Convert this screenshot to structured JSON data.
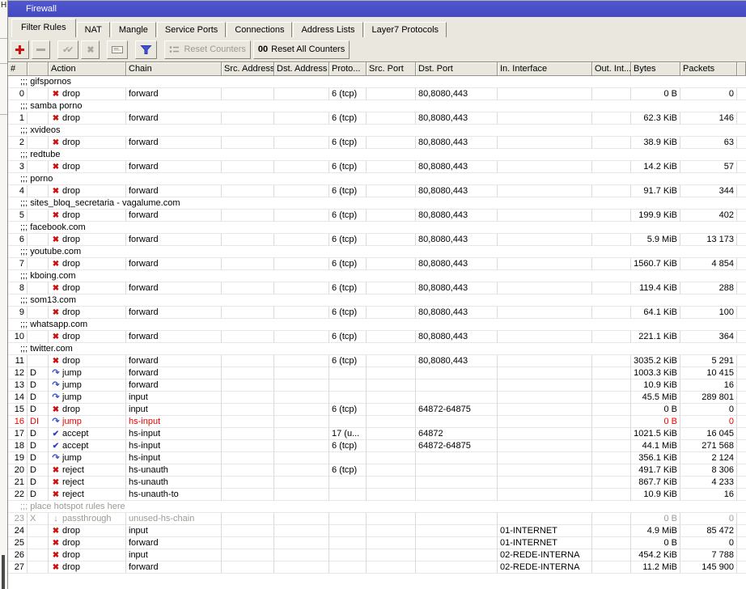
{
  "window": {
    "title": "Firewall"
  },
  "background": {
    "partial_text": "H"
  },
  "tabs": [
    {
      "label": "Filter Rules",
      "active": true
    },
    {
      "label": "NAT",
      "active": false
    },
    {
      "label": "Mangle",
      "active": false
    },
    {
      "label": "Service Ports",
      "active": false
    },
    {
      "label": "Connections",
      "active": false
    },
    {
      "label": "Address Lists",
      "active": false
    },
    {
      "label": "Layer7 Protocols",
      "active": false
    }
  ],
  "toolbar": {
    "reset_counters": "Reset Counters",
    "reset_all_prefix": "00",
    "reset_all": "Reset All Counters"
  },
  "icons": {
    "enable": "✔✔",
    "disable": "✖"
  },
  "action_icons": {
    "drop": "✖",
    "reject": "✖",
    "jump": "↷",
    "accept": "✔",
    "passthrough": "↓"
  },
  "colors": {
    "titlebar_blue": "#4b51c8",
    "chrome_grey": "#eae7df",
    "invalid_red": "#f00000",
    "disabled_grey": "#9c9a92",
    "drop_red": "#cc1111",
    "jump_blue": "#3a55cf",
    "accept_blue": "#2f3fc4"
  },
  "table": {
    "comment_prefix": ";;;",
    "columns": [
      {
        "key": "num",
        "label": "#",
        "align": "right"
      },
      {
        "key": "flags",
        "label": "",
        "align": "left"
      },
      {
        "key": "action",
        "label": "Action",
        "align": "left"
      },
      {
        "key": "chain",
        "label": "Chain",
        "align": "left"
      },
      {
        "key": "src_address",
        "label": "Src. Address",
        "align": "left"
      },
      {
        "key": "dst_address",
        "label": "Dst. Address",
        "align": "left"
      },
      {
        "key": "protocol",
        "label": "Proto...",
        "align": "left"
      },
      {
        "key": "src_port",
        "label": "Src. Port",
        "align": "left"
      },
      {
        "key": "dst_port",
        "label": "Dst. Port",
        "align": "left"
      },
      {
        "key": "in_interface",
        "label": "In. Interface",
        "align": "left"
      },
      {
        "key": "out_interface",
        "label": "Out. Int...",
        "align": "left"
      },
      {
        "key": "bytes",
        "label": "Bytes",
        "align": "right"
      },
      {
        "key": "packets",
        "label": "Packets",
        "align": "right"
      },
      {
        "key": "filler",
        "label": "",
        "align": "left"
      }
    ],
    "rows": [
      {
        "type": "comment",
        "text": "gifspornos"
      },
      {
        "type": "rule",
        "num": "0",
        "flags": "",
        "action": "drop",
        "chain": "forward",
        "protocol": "6 (tcp)",
        "dst_port": "80,8080,443",
        "bytes": "0 B",
        "packets": "0"
      },
      {
        "type": "comment",
        "text": "samba porno"
      },
      {
        "type": "rule",
        "num": "1",
        "flags": "",
        "action": "drop",
        "chain": "forward",
        "protocol": "6 (tcp)",
        "dst_port": "80,8080,443",
        "bytes": "62.3 KiB",
        "packets": "146"
      },
      {
        "type": "comment",
        "text": "xvideos"
      },
      {
        "type": "rule",
        "num": "2",
        "flags": "",
        "action": "drop",
        "chain": "forward",
        "protocol": "6 (tcp)",
        "dst_port": "80,8080,443",
        "bytes": "38.9 KiB",
        "packets": "63"
      },
      {
        "type": "comment",
        "text": "redtube"
      },
      {
        "type": "rule",
        "num": "3",
        "flags": "",
        "action": "drop",
        "chain": "forward",
        "protocol": "6 (tcp)",
        "dst_port": "80,8080,443",
        "bytes": "14.2 KiB",
        "packets": "57"
      },
      {
        "type": "comment",
        "text": "porno"
      },
      {
        "type": "rule",
        "num": "4",
        "flags": "",
        "action": "drop",
        "chain": "forward",
        "protocol": "6 (tcp)",
        "dst_port": "80,8080,443",
        "bytes": "91.7 KiB",
        "packets": "344"
      },
      {
        "type": "comment",
        "text": "sites_bloq_secretaria - vagalume.com"
      },
      {
        "type": "rule",
        "num": "5",
        "flags": "",
        "action": "drop",
        "chain": "forward",
        "protocol": "6 (tcp)",
        "dst_port": "80,8080,443",
        "bytes": "199.9 KiB",
        "packets": "402"
      },
      {
        "type": "comment",
        "text": "facebook.com"
      },
      {
        "type": "rule",
        "num": "6",
        "flags": "",
        "action": "drop",
        "chain": "forward",
        "protocol": "6 (tcp)",
        "dst_port": "80,8080,443",
        "bytes": "5.9 MiB",
        "packets": "13 173"
      },
      {
        "type": "comment",
        "text": "youtube.com"
      },
      {
        "type": "rule",
        "num": "7",
        "flags": "",
        "action": "drop",
        "chain": "forward",
        "protocol": "6 (tcp)",
        "dst_port": "80,8080,443",
        "bytes": "1560.7 KiB",
        "packets": "4 854"
      },
      {
        "type": "comment",
        "text": "kboing.com"
      },
      {
        "type": "rule",
        "num": "8",
        "flags": "",
        "action": "drop",
        "chain": "forward",
        "protocol": "6 (tcp)",
        "dst_port": "80,8080,443",
        "bytes": "119.4 KiB",
        "packets": "288"
      },
      {
        "type": "comment",
        "text": "som13.com"
      },
      {
        "type": "rule",
        "num": "9",
        "flags": "",
        "action": "drop",
        "chain": "forward",
        "protocol": "6 (tcp)",
        "dst_port": "80,8080,443",
        "bytes": "64.1 KiB",
        "packets": "100"
      },
      {
        "type": "comment",
        "text": "whatsapp.com"
      },
      {
        "type": "rule",
        "num": "10",
        "flags": "",
        "action": "drop",
        "chain": "forward",
        "protocol": "6 (tcp)",
        "dst_port": "80,8080,443",
        "bytes": "221.1 KiB",
        "packets": "364"
      },
      {
        "type": "comment",
        "text": "twitter.com"
      },
      {
        "type": "rule",
        "num": "11",
        "flags": "",
        "action": "drop",
        "chain": "forward",
        "protocol": "6 (tcp)",
        "dst_port": "80,8080,443",
        "bytes": "3035.2 KiB",
        "packets": "5 291"
      },
      {
        "type": "rule",
        "num": "12",
        "flags": "D",
        "action": "jump",
        "chain": "forward",
        "bytes": "1003.3 KiB",
        "packets": "10 415"
      },
      {
        "type": "rule",
        "num": "13",
        "flags": "D",
        "action": "jump",
        "chain": "forward",
        "bytes": "10.9 KiB",
        "packets": "16"
      },
      {
        "type": "rule",
        "num": "14",
        "flags": "D",
        "action": "jump",
        "chain": "input",
        "bytes": "45.5 MiB",
        "packets": "289 801"
      },
      {
        "type": "rule",
        "num": "15",
        "flags": "D",
        "action": "drop",
        "chain": "input",
        "protocol": "6 (tcp)",
        "dst_port": "64872-64875",
        "bytes": "0 B",
        "packets": "0"
      },
      {
        "type": "rule",
        "num": "16",
        "flags": "DI",
        "action": "jump",
        "chain": "hs-input",
        "bytes": "0 B",
        "packets": "0",
        "state": "invalid"
      },
      {
        "type": "rule",
        "num": "17",
        "flags": "D",
        "action": "accept",
        "chain": "hs-input",
        "protocol": "17 (u...",
        "dst_port": "64872",
        "bytes": "1021.5 KiB",
        "packets": "16 045"
      },
      {
        "type": "rule",
        "num": "18",
        "flags": "D",
        "action": "accept",
        "chain": "hs-input",
        "protocol": "6 (tcp)",
        "dst_port": "64872-64875",
        "bytes": "44.1 MiB",
        "packets": "271 568"
      },
      {
        "type": "rule",
        "num": "19",
        "flags": "D",
        "action": "jump",
        "chain": "hs-input",
        "bytes": "356.1 KiB",
        "packets": "2 124"
      },
      {
        "type": "rule",
        "num": "20",
        "flags": "D",
        "action": "reject",
        "chain": "hs-unauth",
        "protocol": "6 (tcp)",
        "bytes": "491.7 KiB",
        "packets": "8 306"
      },
      {
        "type": "rule",
        "num": "21",
        "flags": "D",
        "action": "reject",
        "chain": "hs-unauth",
        "bytes": "867.7 KiB",
        "packets": "4 233"
      },
      {
        "type": "rule",
        "num": "22",
        "flags": "D",
        "action": "reject",
        "chain": "hs-unauth-to",
        "bytes": "10.9 KiB",
        "packets": "16"
      },
      {
        "type": "comment",
        "text": "place hotspot rules here",
        "state": "disabled"
      },
      {
        "type": "rule",
        "num": "23",
        "flags": "X",
        "action": "passthrough",
        "chain": "unused-hs-chain",
        "bytes": "0 B",
        "packets": "0",
        "state": "disabled"
      },
      {
        "type": "rule",
        "num": "24",
        "flags": "",
        "action": "drop",
        "chain": "input",
        "in_interface": "01-INTERNET",
        "bytes": "4.9 MiB",
        "packets": "85 472"
      },
      {
        "type": "rule",
        "num": "25",
        "flags": "",
        "action": "drop",
        "chain": "forward",
        "in_interface": "01-INTERNET",
        "bytes": "0 B",
        "packets": "0"
      },
      {
        "type": "rule",
        "num": "26",
        "flags": "",
        "action": "drop",
        "chain": "input",
        "in_interface": "02-REDE-INTERNA",
        "bytes": "454.2 KiB",
        "packets": "7 788"
      },
      {
        "type": "rule",
        "num": "27",
        "flags": "",
        "action": "drop",
        "chain": "forward",
        "in_interface": "02-REDE-INTERNA",
        "bytes": "11.2 MiB",
        "packets": "145 900"
      }
    ]
  }
}
